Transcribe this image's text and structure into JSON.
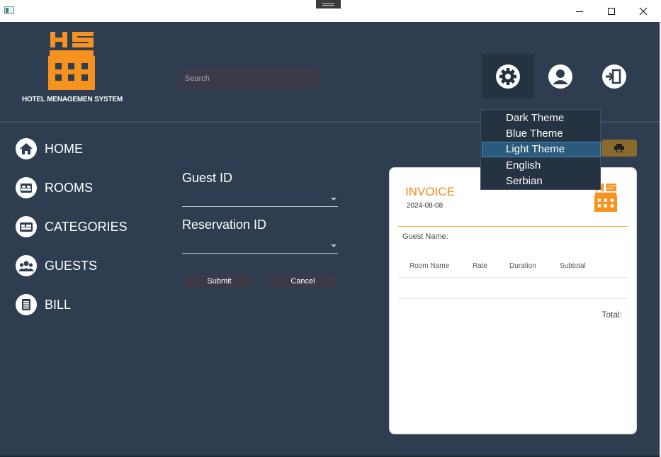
{
  "app": {
    "logo_text": "HS",
    "logo_caption": "HOTEL MENAGEMEN SYSTEM"
  },
  "search": {
    "placeholder": "Search"
  },
  "toolbar_icons": [
    "gear-icon",
    "user-icon",
    "logout-icon"
  ],
  "settings_menu": {
    "items": [
      "Dark Theme",
      "Blue Theme",
      "Light Theme",
      "English",
      "Serbian"
    ],
    "highlighted": "Light Theme"
  },
  "sidebar": {
    "items": [
      {
        "label": "HOME",
        "icon": "home-icon"
      },
      {
        "label": "ROOMS",
        "icon": "bed-icon"
      },
      {
        "label": "CATEGORIES",
        "icon": "categories-icon"
      },
      {
        "label": "GUESTS",
        "icon": "guests-icon"
      },
      {
        "label": "BILL",
        "icon": "bill-icon"
      }
    ]
  },
  "form": {
    "guest_id_label": "Guest ID",
    "guest_id_value": "",
    "reservation_id_label": "Reservation ID",
    "reservation_id_value": "",
    "submit_label": "Submit",
    "cancel_label": "Cancel"
  },
  "invoice": {
    "title": "INVOICE",
    "date": "2024-08-08",
    "guest_name_label": "Guest Name:",
    "columns": [
      "Room Name",
      "Rate",
      "Duration",
      "Subtotal"
    ],
    "rows": [],
    "total_label": "Total:"
  },
  "colors": {
    "background": "#2e3e50",
    "accent_orange": "#f28a12",
    "button_dark": "#3b3a48",
    "print_button": "#8a6a2e",
    "menu_background": "#243241",
    "menu_highlight": "#2c5a7c"
  }
}
